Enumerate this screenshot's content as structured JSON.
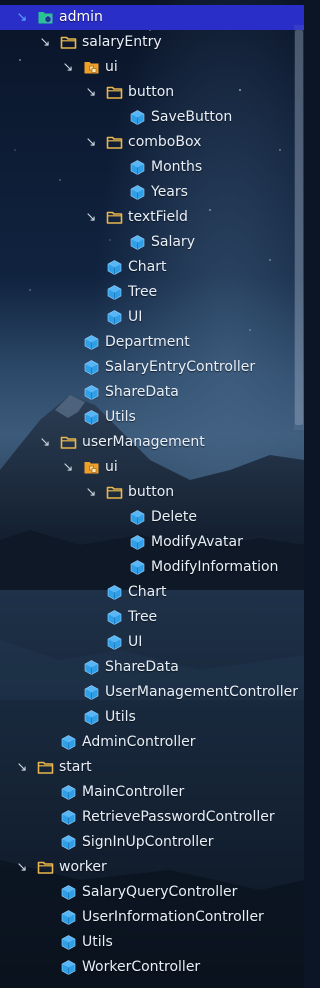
{
  "colors": {
    "selection": "#2a2ec8",
    "class_icon": "#2f9fe8",
    "folder_icon": "#e8b64c",
    "package_icon": "#f0a028",
    "module_icon": "#27c48f"
  },
  "tree": [
    {
      "label": "admin",
      "depth": 0,
      "icon": "module-folder-icon",
      "expanded": true,
      "selected": true
    },
    {
      "label": "salaryEntry",
      "depth": 1,
      "icon": "folder-icon",
      "expanded": true
    },
    {
      "label": "ui",
      "depth": 2,
      "icon": "package-icon",
      "expanded": true
    },
    {
      "label": "button",
      "depth": 3,
      "icon": "folder-icon",
      "expanded": true
    },
    {
      "label": "SaveButton",
      "depth": 4,
      "icon": "class-icon"
    },
    {
      "label": "comboBox",
      "depth": 3,
      "icon": "folder-icon",
      "expanded": true
    },
    {
      "label": "Months",
      "depth": 4,
      "icon": "class-icon"
    },
    {
      "label": "Years",
      "depth": 4,
      "icon": "class-icon"
    },
    {
      "label": "textField",
      "depth": 3,
      "icon": "folder-icon",
      "expanded": true
    },
    {
      "label": "Salary",
      "depth": 4,
      "icon": "class-icon"
    },
    {
      "label": "Chart",
      "depth": 3,
      "icon": "class-icon"
    },
    {
      "label": "Tree",
      "depth": 3,
      "icon": "class-icon"
    },
    {
      "label": "UI",
      "depth": 3,
      "icon": "class-icon"
    },
    {
      "label": "Department",
      "depth": 2,
      "icon": "class-icon"
    },
    {
      "label": "SalaryEntryController",
      "depth": 2,
      "icon": "class-icon"
    },
    {
      "label": "ShareData",
      "depth": 2,
      "icon": "class-icon"
    },
    {
      "label": "Utils",
      "depth": 2,
      "icon": "class-icon"
    },
    {
      "label": "userManagement",
      "depth": 1,
      "icon": "folder-icon",
      "expanded": true
    },
    {
      "label": "ui",
      "depth": 2,
      "icon": "package-icon",
      "expanded": true
    },
    {
      "label": "button",
      "depth": 3,
      "icon": "folder-icon",
      "expanded": true
    },
    {
      "label": "Delete",
      "depth": 4,
      "icon": "class-icon"
    },
    {
      "label": "ModifyAvatar",
      "depth": 4,
      "icon": "class-icon"
    },
    {
      "label": "ModifyInformation",
      "depth": 4,
      "icon": "class-icon"
    },
    {
      "label": "Chart",
      "depth": 3,
      "icon": "class-icon"
    },
    {
      "label": "Tree",
      "depth": 3,
      "icon": "class-icon"
    },
    {
      "label": "UI",
      "depth": 3,
      "icon": "class-icon"
    },
    {
      "label": "ShareData",
      "depth": 2,
      "icon": "class-icon"
    },
    {
      "label": "UserManagementController",
      "depth": 2,
      "icon": "class-icon"
    },
    {
      "label": "Utils",
      "depth": 2,
      "icon": "class-icon"
    },
    {
      "label": "AdminController",
      "depth": 1,
      "icon": "class-icon"
    },
    {
      "label": "start",
      "depth": 0,
      "icon": "folder-icon",
      "expanded": true
    },
    {
      "label": "MainController",
      "depth": 1,
      "icon": "class-icon"
    },
    {
      "label": "RetrievePasswordController",
      "depth": 1,
      "icon": "class-icon"
    },
    {
      "label": "SignInUpController",
      "depth": 1,
      "icon": "class-icon"
    },
    {
      "label": "worker",
      "depth": 0,
      "icon": "folder-icon",
      "expanded": true
    },
    {
      "label": "SalaryQueryController",
      "depth": 1,
      "icon": "class-icon"
    },
    {
      "label": "UserInformationController",
      "depth": 1,
      "icon": "class-icon"
    },
    {
      "label": "Utils",
      "depth": 1,
      "icon": "class-icon"
    },
    {
      "label": "WorkerController",
      "depth": 1,
      "icon": "class-icon"
    }
  ]
}
